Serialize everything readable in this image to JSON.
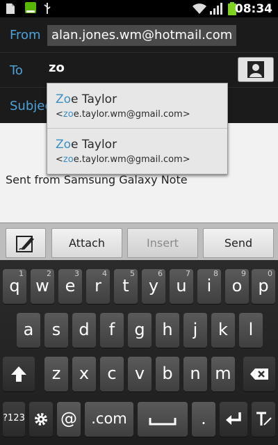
{
  "status_bar": {
    "time": "08:34"
  },
  "compose": {
    "from_label": "From",
    "from_value": "alan.jones.wm@hotmail.com",
    "to_label": "To",
    "to_value": "zo",
    "subject_label": "Subject"
  },
  "suggestions": [
    {
      "name_match": "Zo",
      "name_rest": "e Taylor",
      "email_prefix": "<",
      "email_match": "zo",
      "email_rest": "e.taylor.wm@gmail.com>"
    },
    {
      "name_match": "Zo",
      "name_rest": "e Taylor",
      "email_prefix": "<",
      "email_match": "zo",
      "email_rest": "e.taylor.wm@gmail.com>"
    }
  ],
  "body": {
    "signature": "Sent from Samsung Galaxy Note"
  },
  "toolbar": {
    "attach": "Attach",
    "insert": "Insert",
    "send": "Send"
  },
  "keyboard": {
    "row1": [
      {
        "k": "q",
        "h": "1"
      },
      {
        "k": "w",
        "h": "2"
      },
      {
        "k": "e",
        "h": "3"
      },
      {
        "k": "r",
        "h": "4"
      },
      {
        "k": "t",
        "h": "5"
      },
      {
        "k": "y",
        "h": "6"
      },
      {
        "k": "u",
        "h": "7"
      },
      {
        "k": "i",
        "h": "8"
      },
      {
        "k": "o",
        "h": "9"
      },
      {
        "k": "p",
        "h": "0"
      }
    ],
    "row2": [
      "a",
      "s",
      "d",
      "f",
      "g",
      "h",
      "j",
      "k",
      "l"
    ],
    "row3": [
      "z",
      "x",
      "c",
      "v",
      "b",
      "n",
      "m"
    ],
    "mode_key": "?123",
    "at_key": "@",
    "com_key": ".com",
    "period_key": "."
  }
}
